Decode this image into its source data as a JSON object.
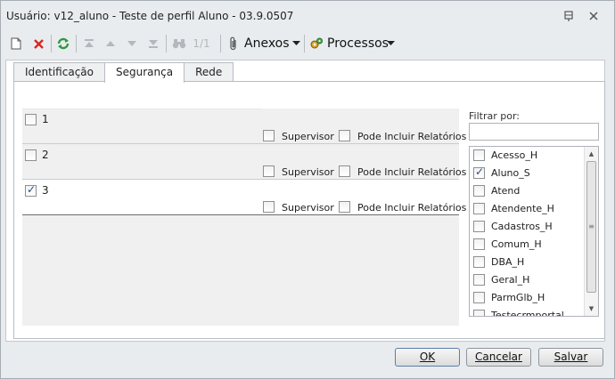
{
  "window": {
    "title": "Usuário: v12_aluno - Teste de perfil Aluno - 03.9.0507"
  },
  "toolbar": {
    "pager": "1/1",
    "anexos_label": "Anexos",
    "processos_label": "Processos"
  },
  "tabs": [
    {
      "label": "Identificação",
      "active": false
    },
    {
      "label": "Segurança",
      "active": true
    },
    {
      "label": "Rede",
      "active": false
    }
  ],
  "roles": [
    {
      "name": "1",
      "checked": false,
      "supervisor_label": "Supervisor",
      "supervisor_checked": false,
      "relatorios_label": "Pode Incluir Relatórios",
      "relatorios_checked": false
    },
    {
      "name": "2",
      "checked": false,
      "supervisor_label": "Supervisor",
      "supervisor_checked": false,
      "relatorios_label": "Pode Incluir Relatórios",
      "relatorios_checked": false
    },
    {
      "name": "3",
      "checked": true,
      "supervisor_label": "Supervisor",
      "supervisor_checked": false,
      "relatorios_label": "Pode Incluir Relatórios",
      "relatorios_checked": false
    }
  ],
  "filter": {
    "label": "Filtrar por:",
    "value": ""
  },
  "profiles": [
    {
      "label": "Acesso_H",
      "checked": false
    },
    {
      "label": "Aluno_S",
      "checked": true
    },
    {
      "label": "Atend",
      "checked": false
    },
    {
      "label": "Atendente_H",
      "checked": false
    },
    {
      "label": "Cadastros_H",
      "checked": false
    },
    {
      "label": "Comum_H",
      "checked": false
    },
    {
      "label": "DBA_H",
      "checked": false
    },
    {
      "label": "Geral_H",
      "checked": false
    },
    {
      "label": "ParmGlb_H",
      "checked": false
    },
    {
      "label": "Testecrmportal",
      "checked": false
    }
  ],
  "buttons": {
    "ok_label": "OK",
    "cancel_label": "Cancelar",
    "save_label": "Salvar"
  },
  "colors": {
    "delete_icon": "#d9261c",
    "refresh_icon": "#2e9a3a",
    "check": "#2a4e8a"
  }
}
